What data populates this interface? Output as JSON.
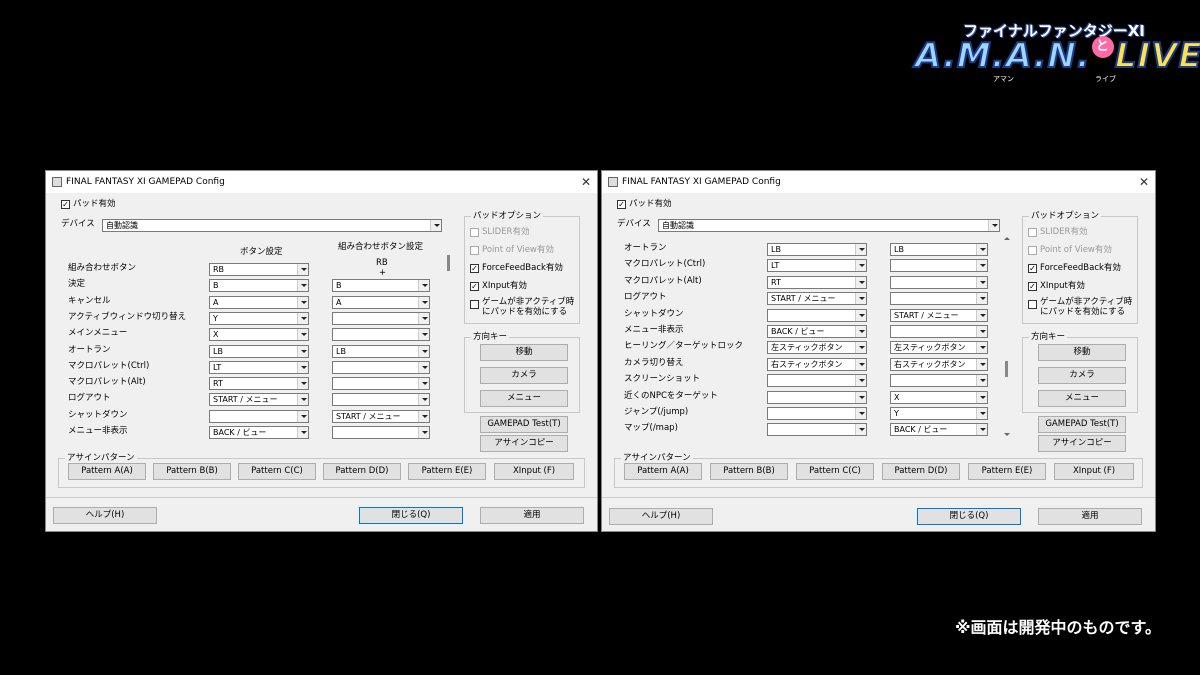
{
  "logo": {
    "subtitle": "ファイナルファンタジーXI",
    "part1": "A.M.A.N.",
    "to": "と",
    "part2": "LIVE!",
    "ruby1": "アマン",
    "ruby2": "ライブ"
  },
  "caption": "※画面は開発中のものです。",
  "dialogs": [
    {
      "title": "FINAL FANTASY XI GAMEPAD Config",
      "pad_enabled": "パッド有効",
      "device_label": "デバイス",
      "device_value": "自動認識",
      "col_button": "ボタン設定",
      "col_combo": "組み合わせボタン設定",
      "combo_header_line1": "RB",
      "combo_header_line2": "+",
      "rows": [
        {
          "label": "組み合わせボタン",
          "button": "RB",
          "combo": null
        },
        {
          "label": "決定",
          "button": "B",
          "combo": "B"
        },
        {
          "label": "キャンセル",
          "button": "A",
          "combo": "A"
        },
        {
          "label": "アクティブウィンドウ切り替え",
          "button": "Y",
          "combo": ""
        },
        {
          "label": "メインメニュー",
          "button": "X",
          "combo": ""
        },
        {
          "label": "オートラン",
          "button": "LB",
          "combo": "LB"
        },
        {
          "label": "マクロパレット(Ctrl)",
          "button": "LT",
          "combo": ""
        },
        {
          "label": "マクロパレット(Alt)",
          "button": "RT",
          "combo": ""
        },
        {
          "label": "ログアウト",
          "button": "START / メニュー",
          "combo": ""
        },
        {
          "label": "シャットダウン",
          "button": "",
          "combo": "START / メニュー"
        },
        {
          "label": "メニュー非表示",
          "button": "BACK / ビュー",
          "combo": ""
        }
      ]
    },
    {
      "title": "FINAL FANTASY XI GAMEPAD Config",
      "pad_enabled": "パッド有効",
      "device_label": "デバイス",
      "device_value": "自動認識",
      "rows": [
        {
          "label": "オートラン",
          "button": "LB",
          "combo": "LB"
        },
        {
          "label": "マクロパレット(Ctrl)",
          "button": "LT",
          "combo": ""
        },
        {
          "label": "マクロパレット(Alt)",
          "button": "RT",
          "combo": ""
        },
        {
          "label": "ログアウト",
          "button": "START / メニュー",
          "combo": ""
        },
        {
          "label": "シャットダウン",
          "button": "",
          "combo": "START / メニュー"
        },
        {
          "label": "メニュー非表示",
          "button": "BACK / ビュー",
          "combo": ""
        },
        {
          "label": "ヒーリング／ターゲットロック",
          "button": "左スティックボタン",
          "combo": "左スティックボタン"
        },
        {
          "label": "カメラ切り替え",
          "button": "右スティックボタン",
          "combo": "右スティックボタン"
        },
        {
          "label": "スクリーンショット",
          "button": "",
          "combo": ""
        },
        {
          "label": "近くのNPCをターゲット",
          "button": "",
          "combo": "X"
        },
        {
          "label": "ジャンプ(/jump)",
          "button": "",
          "combo": "Y"
        },
        {
          "label": "マップ(/map)",
          "button": "",
          "combo": "BACK / ビュー"
        }
      ]
    }
  ],
  "pad_options": {
    "title": "パッドオプション",
    "slider": "SLIDER有効",
    "pov": "Point of View有効",
    "force": "ForceFeedBack有効",
    "xinput": "XInput有効",
    "inactive_line1": "ゲームが非アクティブ時",
    "inactive_line2": "にパッドを有効にする"
  },
  "direction": {
    "title": "方向キー",
    "move": "移動",
    "camera": "カメラ",
    "menu": "メニュー"
  },
  "gamepad_test": "GAMEPAD Test(T)",
  "assign_copy": "アサインコピー",
  "assign_pattern": {
    "title": "アサインパターン",
    "buttons": [
      "Pattern A(A)",
      "Pattern B(B)",
      "Pattern C(C)",
      "Pattern D(D)",
      "Pattern E(E)",
      "XInput (F)"
    ]
  },
  "footer": {
    "help": "ヘルプ(H)",
    "close": "閉じる(Q)",
    "apply": "適用"
  }
}
